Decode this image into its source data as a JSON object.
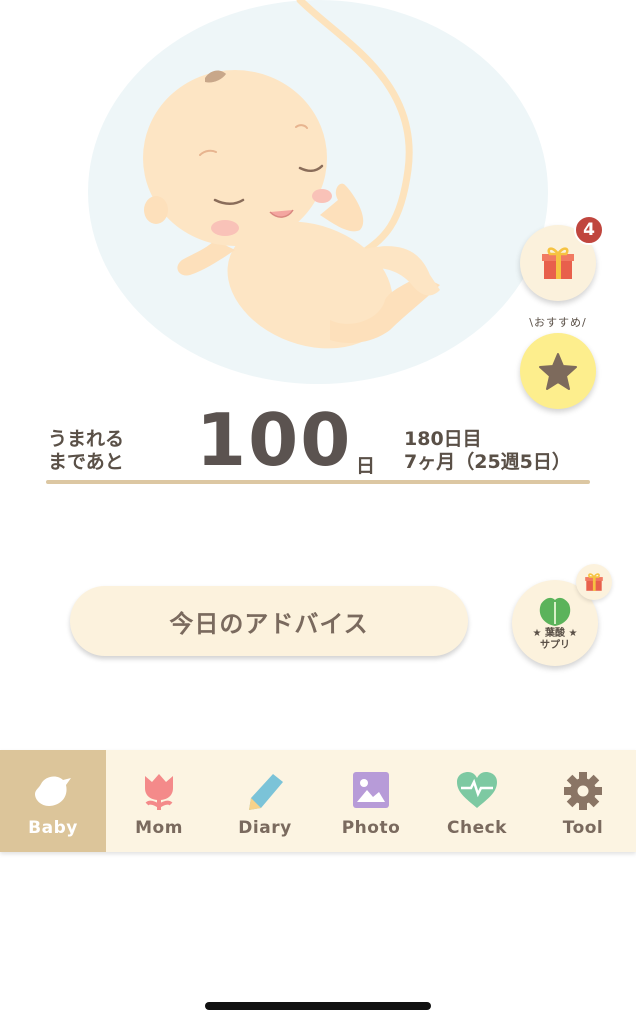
{
  "gift": {
    "badge_count": "4"
  },
  "recommend": {
    "label": "\\おすすめ/"
  },
  "countdown": {
    "left_line1": "うまれる",
    "left_line2": "まであと",
    "days": "100",
    "unit": "日",
    "right_line1": "180日目",
    "right_line2": "7ヶ月（25週5日）"
  },
  "advice": {
    "label": "今日のアドバイス"
  },
  "supplement": {
    "line1": "★ 葉酸 ★",
    "line2": "サプリ"
  },
  "tabs": [
    {
      "label": "Baby",
      "icon": "bird-icon"
    },
    {
      "label": "Mom",
      "icon": "tulip-icon"
    },
    {
      "label": "Diary",
      "icon": "pencil-icon"
    },
    {
      "label": "Photo",
      "icon": "photo-icon"
    },
    {
      "label": "Check",
      "icon": "heartbeat-icon"
    },
    {
      "label": "Tool",
      "icon": "gear-icon"
    }
  ],
  "colors": {
    "accent": "#dcc59a",
    "badge": "#c0463e",
    "star_bg": "#fdee8d",
    "tab_bg": "#fcf4e2"
  }
}
